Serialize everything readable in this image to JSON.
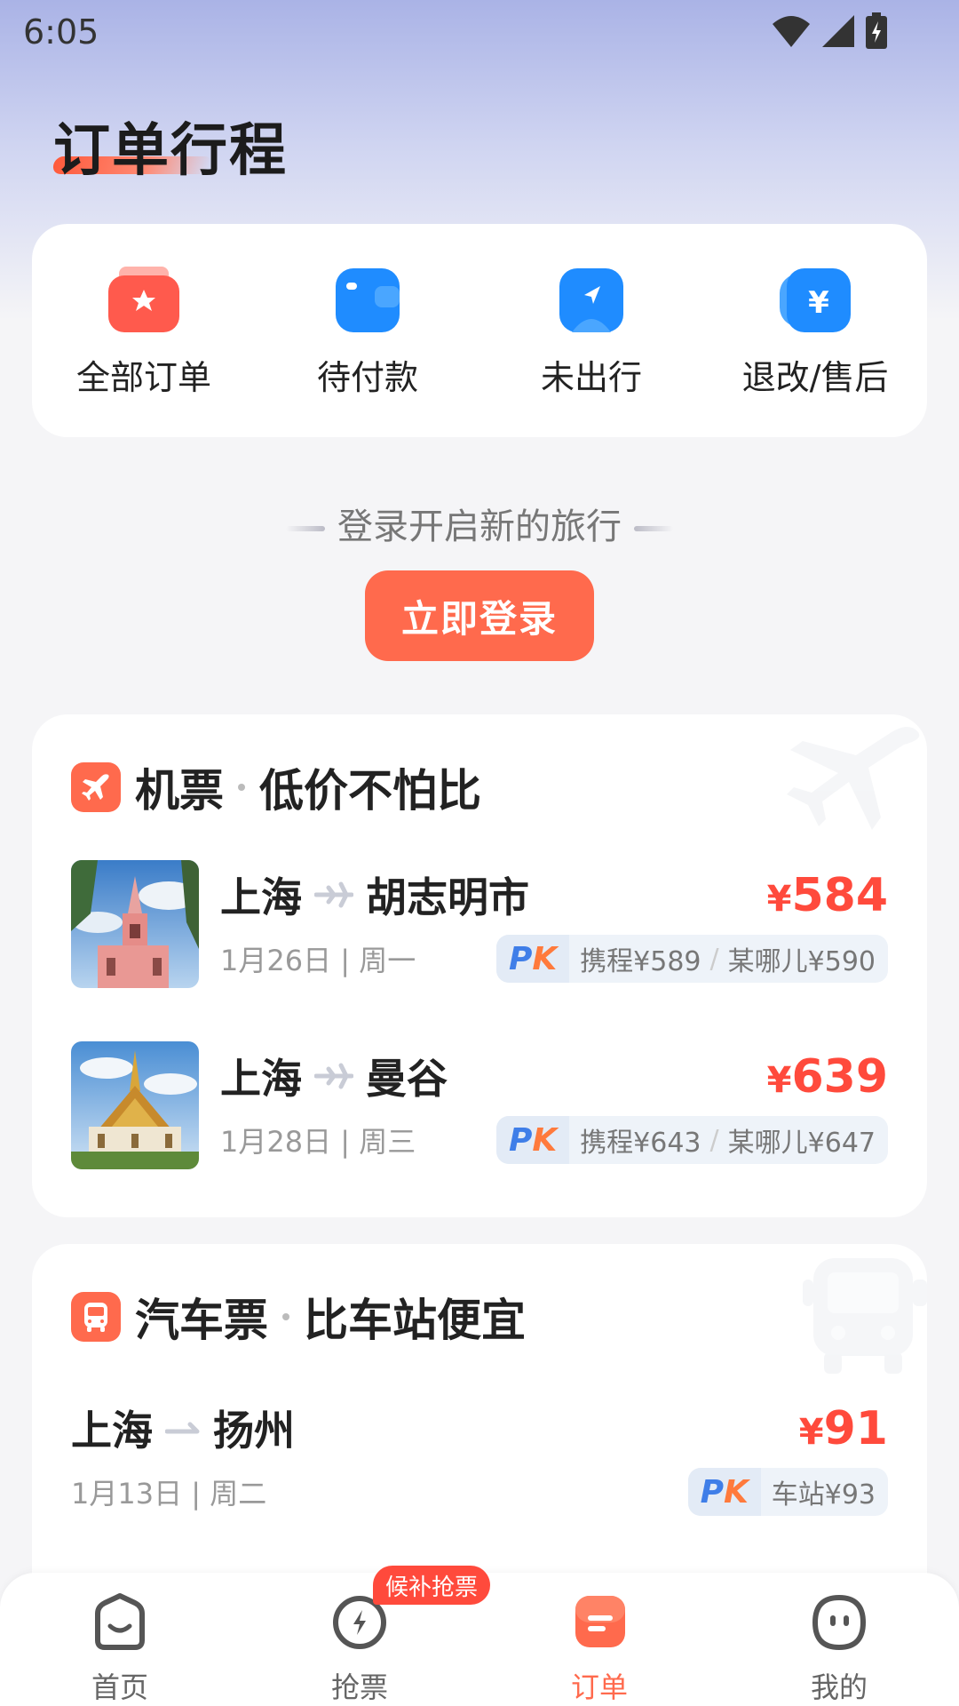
{
  "status_bar": {
    "time": "6:05"
  },
  "page": {
    "title": "订单行程"
  },
  "order_shortcuts": [
    {
      "label": "全部订单",
      "icon": "all-orders-icon",
      "color": "#ff5a4d"
    },
    {
      "label": "待付款",
      "icon": "wallet-icon",
      "color": "#1f8cff"
    },
    {
      "label": "未出行",
      "icon": "navigation-icon",
      "color": "#1f8cff"
    },
    {
      "label": "退改/售后",
      "icon": "refund-icon",
      "color": "#1f8cff"
    }
  ],
  "login": {
    "prompt": "登录开启新的旅行",
    "button_label": "立即登录"
  },
  "flight_section": {
    "title": "机票",
    "subtitle": "低价不怕比",
    "routes": [
      {
        "from": "上海",
        "to": "胡志明市",
        "date": "1月26日 | 周一",
        "price_symbol": "¥",
        "price": "584",
        "compare_1": "携程¥589",
        "compare_2": "某哪儿¥590"
      },
      {
        "from": "上海",
        "to": "曼谷",
        "date": "1月28日 | 周三",
        "price_symbol": "¥",
        "price": "639",
        "compare_1": "携程¥643",
        "compare_2": "某哪儿¥647"
      }
    ]
  },
  "bus_section": {
    "title": "汽车票",
    "subtitle": "比车站便宜",
    "routes": [
      {
        "from": "上海",
        "to": "扬州",
        "date": "1月13日 | 周二",
        "price_symbol": "¥",
        "price": "91",
        "compare_1": "车站¥93"
      }
    ]
  },
  "tab_bar": {
    "items": [
      {
        "label": "首页",
        "icon": "home-icon",
        "active": false
      },
      {
        "label": "抢票",
        "icon": "grab-ticket-icon",
        "active": false
      },
      {
        "label": "订单",
        "icon": "order-icon",
        "active": true
      },
      {
        "label": "我的",
        "icon": "profile-icon",
        "active": false
      }
    ],
    "badge": "候补抢票"
  },
  "colors": {
    "accent": "#ff6a4d",
    "price": "#ff4a3c",
    "blue": "#1f8cff"
  }
}
